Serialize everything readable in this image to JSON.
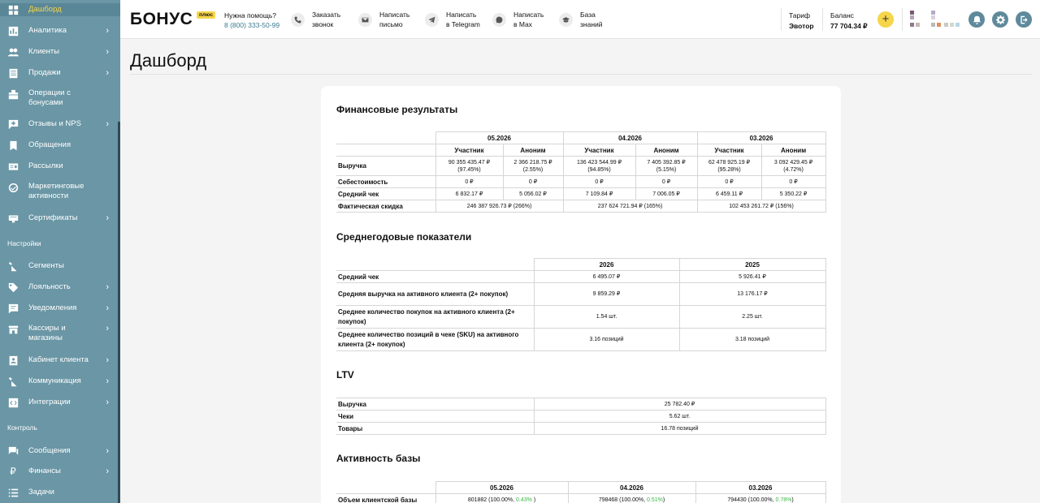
{
  "sidebar": {
    "items": [
      {
        "label": "Дашборд",
        "icon": "dashboard-icon"
      },
      {
        "label": "Аналитика",
        "icon": "analytics-icon"
      },
      {
        "label": "Клиенты",
        "icon": "clients-icon"
      },
      {
        "label": "Продажи",
        "icon": "sales-icon"
      },
      {
        "label": "Операции с бонусами",
        "icon": "bonus-operations-icon"
      },
      {
        "label": "Отзывы и NPS",
        "icon": "reviews-icon"
      },
      {
        "label": "Обращения",
        "icon": "requests-icon"
      },
      {
        "label": "Рассылки",
        "icon": "mailing-icon"
      },
      {
        "label": "Маркетинговые активности",
        "icon": "marketing-icon"
      },
      {
        "label": "Сертификаты",
        "icon": "certificates-icon"
      },
      {
        "label": "Сегменты",
        "icon": "segments-icon"
      },
      {
        "label": "Лояльность",
        "icon": "loyalty-icon"
      },
      {
        "label": "Уведомления",
        "icon": "notifications-icon"
      },
      {
        "label": "Кассиры и магазины",
        "icon": "cashiers-icon"
      },
      {
        "label": "Кабинет клиента",
        "icon": "client-cabinet-icon"
      },
      {
        "label": "Коммуникация",
        "icon": "communication-icon"
      },
      {
        "label": "Интеграции",
        "icon": "integrations-icon"
      },
      {
        "label": "Сообщения",
        "icon": "messages-icon"
      },
      {
        "label": "Финансы",
        "icon": "finance-icon"
      },
      {
        "label": "Задачи",
        "icon": "tasks-icon"
      }
    ],
    "section_settings": "Настройки",
    "section_control": "Контроль"
  },
  "header": {
    "logo": "БОНУС",
    "logo_badge": "плюс",
    "help_title": "Нужна помощь?",
    "help_phone": "8 (800) 333-50-99",
    "actions": [
      {
        "line1": "Заказать",
        "line2": "звонок",
        "icon": "phone-icon"
      },
      {
        "line1": "Написать",
        "line2": "письмо",
        "icon": "mail-icon"
      },
      {
        "line1": "Написать",
        "line2": "в Telegram",
        "icon": "telegram-icon"
      },
      {
        "line1": "Написать",
        "line2": "в Max",
        "icon": "max-chat-icon"
      },
      {
        "line1": "База",
        "line2": "знаний",
        "icon": "knowledge-base-icon"
      }
    ],
    "tariff_label": "Тариф",
    "tariff_value": "Эвотор",
    "balance_label": "Баланс",
    "balance_value": "77 704.34 ₽",
    "add_label": "+"
  },
  "page": {
    "title": "Дашборд"
  },
  "financial": {
    "title": "Финансовые результаты",
    "periods": [
      "05.2026",
      "04.2026",
      "03.2026"
    ],
    "sub": [
      "Участник",
      "Аноним"
    ],
    "rows": [
      {
        "label": "Выручка",
        "cells": [
          {
            "v": "90 355 435.47 ₽",
            "p": "(97.45%)"
          },
          {
            "v": "2 366 218.75 ₽",
            "p": "(2.55%)"
          },
          {
            "v": "136 423 544.99 ₽",
            "p": "(94.85%)"
          },
          {
            "v": "7 405 392.85 ₽",
            "p": "(5.15%)"
          },
          {
            "v": "62 478 925.19 ₽",
            "p": "(95.28%)"
          },
          {
            "v": "3 092 429.45 ₽",
            "p": "(4.72%)"
          }
        ]
      },
      {
        "label": "Себестоимость",
        "cells": [
          {
            "v": "0 ₽"
          },
          {
            "v": "0 ₽"
          },
          {
            "v": "0 ₽"
          },
          {
            "v": "0 ₽"
          },
          {
            "v": "0 ₽"
          },
          {
            "v": "0 ₽"
          }
        ]
      },
      {
        "label": "Средний чек",
        "cells": [
          {
            "v": "6 832.17 ₽"
          },
          {
            "v": "5 056.02 ₽"
          },
          {
            "v": "7 109.84 ₽"
          },
          {
            "v": "7 006.05 ₽"
          },
          {
            "v": "6 459.11 ₽"
          },
          {
            "v": "5 350.22 ₽"
          }
        ]
      }
    ],
    "discount_label": "Фактическая скидка",
    "discount": [
      "246 387 926.73 ₽ (266%)",
      "237 624 721.94 ₽ (165%)",
      "102 453 261.72 ₽ (156%)"
    ]
  },
  "yearly": {
    "title": "Среднегодовые показатели",
    "years": [
      "2026",
      "2025"
    ],
    "rows": [
      {
        "label": "Средний чек",
        "v": [
          "6 495.07 ₽",
          "5 926.41 ₽"
        ]
      },
      {
        "label": "Средняя выручка на активного клиента (2+ покупок)",
        "v": [
          "9 859.29 ₽",
          "13 176.17 ₽"
        ]
      },
      {
        "label": "Среднее количество покупок на активного клиента (2+ покупок)",
        "v": [
          "1.54 шт.",
          "2.25 шт."
        ]
      },
      {
        "label": "Среднее количество позиций в чеке (SKU) на активного клиента (2+ покупок)",
        "v": [
          "3.16 позиций",
          "3.18 позиций"
        ]
      }
    ]
  },
  "ltv": {
    "title": "LTV",
    "rows": [
      {
        "label": "Выручка",
        "v": "25 782.40 ₽"
      },
      {
        "label": "Чеки",
        "v": "5.62 шт."
      },
      {
        "label": "Товары",
        "v": "16.78 позиций"
      }
    ]
  },
  "activity": {
    "title": "Активность базы",
    "periods": [
      "05.2026",
      "04.2026",
      "03.2026"
    ],
    "row_label": "Объем клиентской базы",
    "cells": [
      {
        "v": "801882 (100.00%, ",
        "g": "0.43%",
        "e": " )"
      },
      {
        "v": "798468 (100.00%, ",
        "g": "0.51%",
        "e": ")"
      },
      {
        "v": "794430 (100.00%, ",
        "g": "0.78%",
        "e": ")"
      }
    ]
  },
  "colors": {
    "sidebar": "#6a96a5",
    "accent": "#f5d54a",
    "round_button": "#5e8a9b",
    "positive": "#3fb543"
  }
}
